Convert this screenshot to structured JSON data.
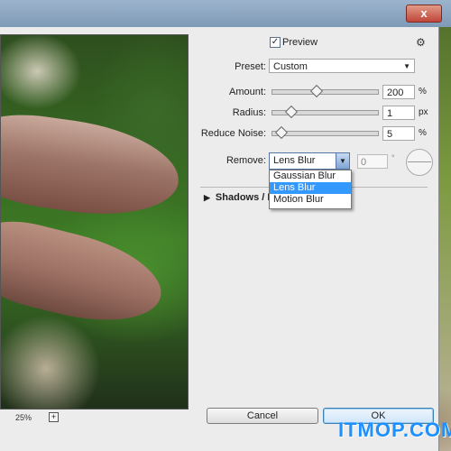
{
  "window": {
    "close_glyph": "x"
  },
  "preview": {
    "checkbox_checked": "✓",
    "label": "Preview",
    "gear_glyph": "⚙",
    "zoom": "25%",
    "zoom_plus": "+"
  },
  "preset": {
    "label": "Preset:",
    "value": "Custom",
    "arrow": "▼"
  },
  "amount": {
    "label": "Amount:",
    "value": "200",
    "unit": "%",
    "slider_fraction": 0.4
  },
  "radius": {
    "label": "Radius:",
    "value": "1",
    "unit": "px",
    "slider_fraction": 0.15
  },
  "reduce_noise": {
    "label": "Reduce Noise:",
    "value": "5",
    "unit": "%",
    "slider_fraction": 0.05
  },
  "remove": {
    "label": "Remove:",
    "value": "Lens Blur",
    "arrow": "▼",
    "angle_value": "0",
    "angle_unit": "°",
    "options": [
      "Gaussian Blur",
      "Lens Blur",
      "Motion Blur"
    ],
    "selected_index": 1
  },
  "section": {
    "label": "Shadows / H",
    "arrow": "▶"
  },
  "buttons": {
    "cancel": "Cancel",
    "ok": "OK"
  },
  "watermark": "ITMOP.COM",
  "colors": {
    "selection": "#3399ff",
    "ok_border": "#3c7fb1",
    "watermark": "#1e90ff"
  }
}
